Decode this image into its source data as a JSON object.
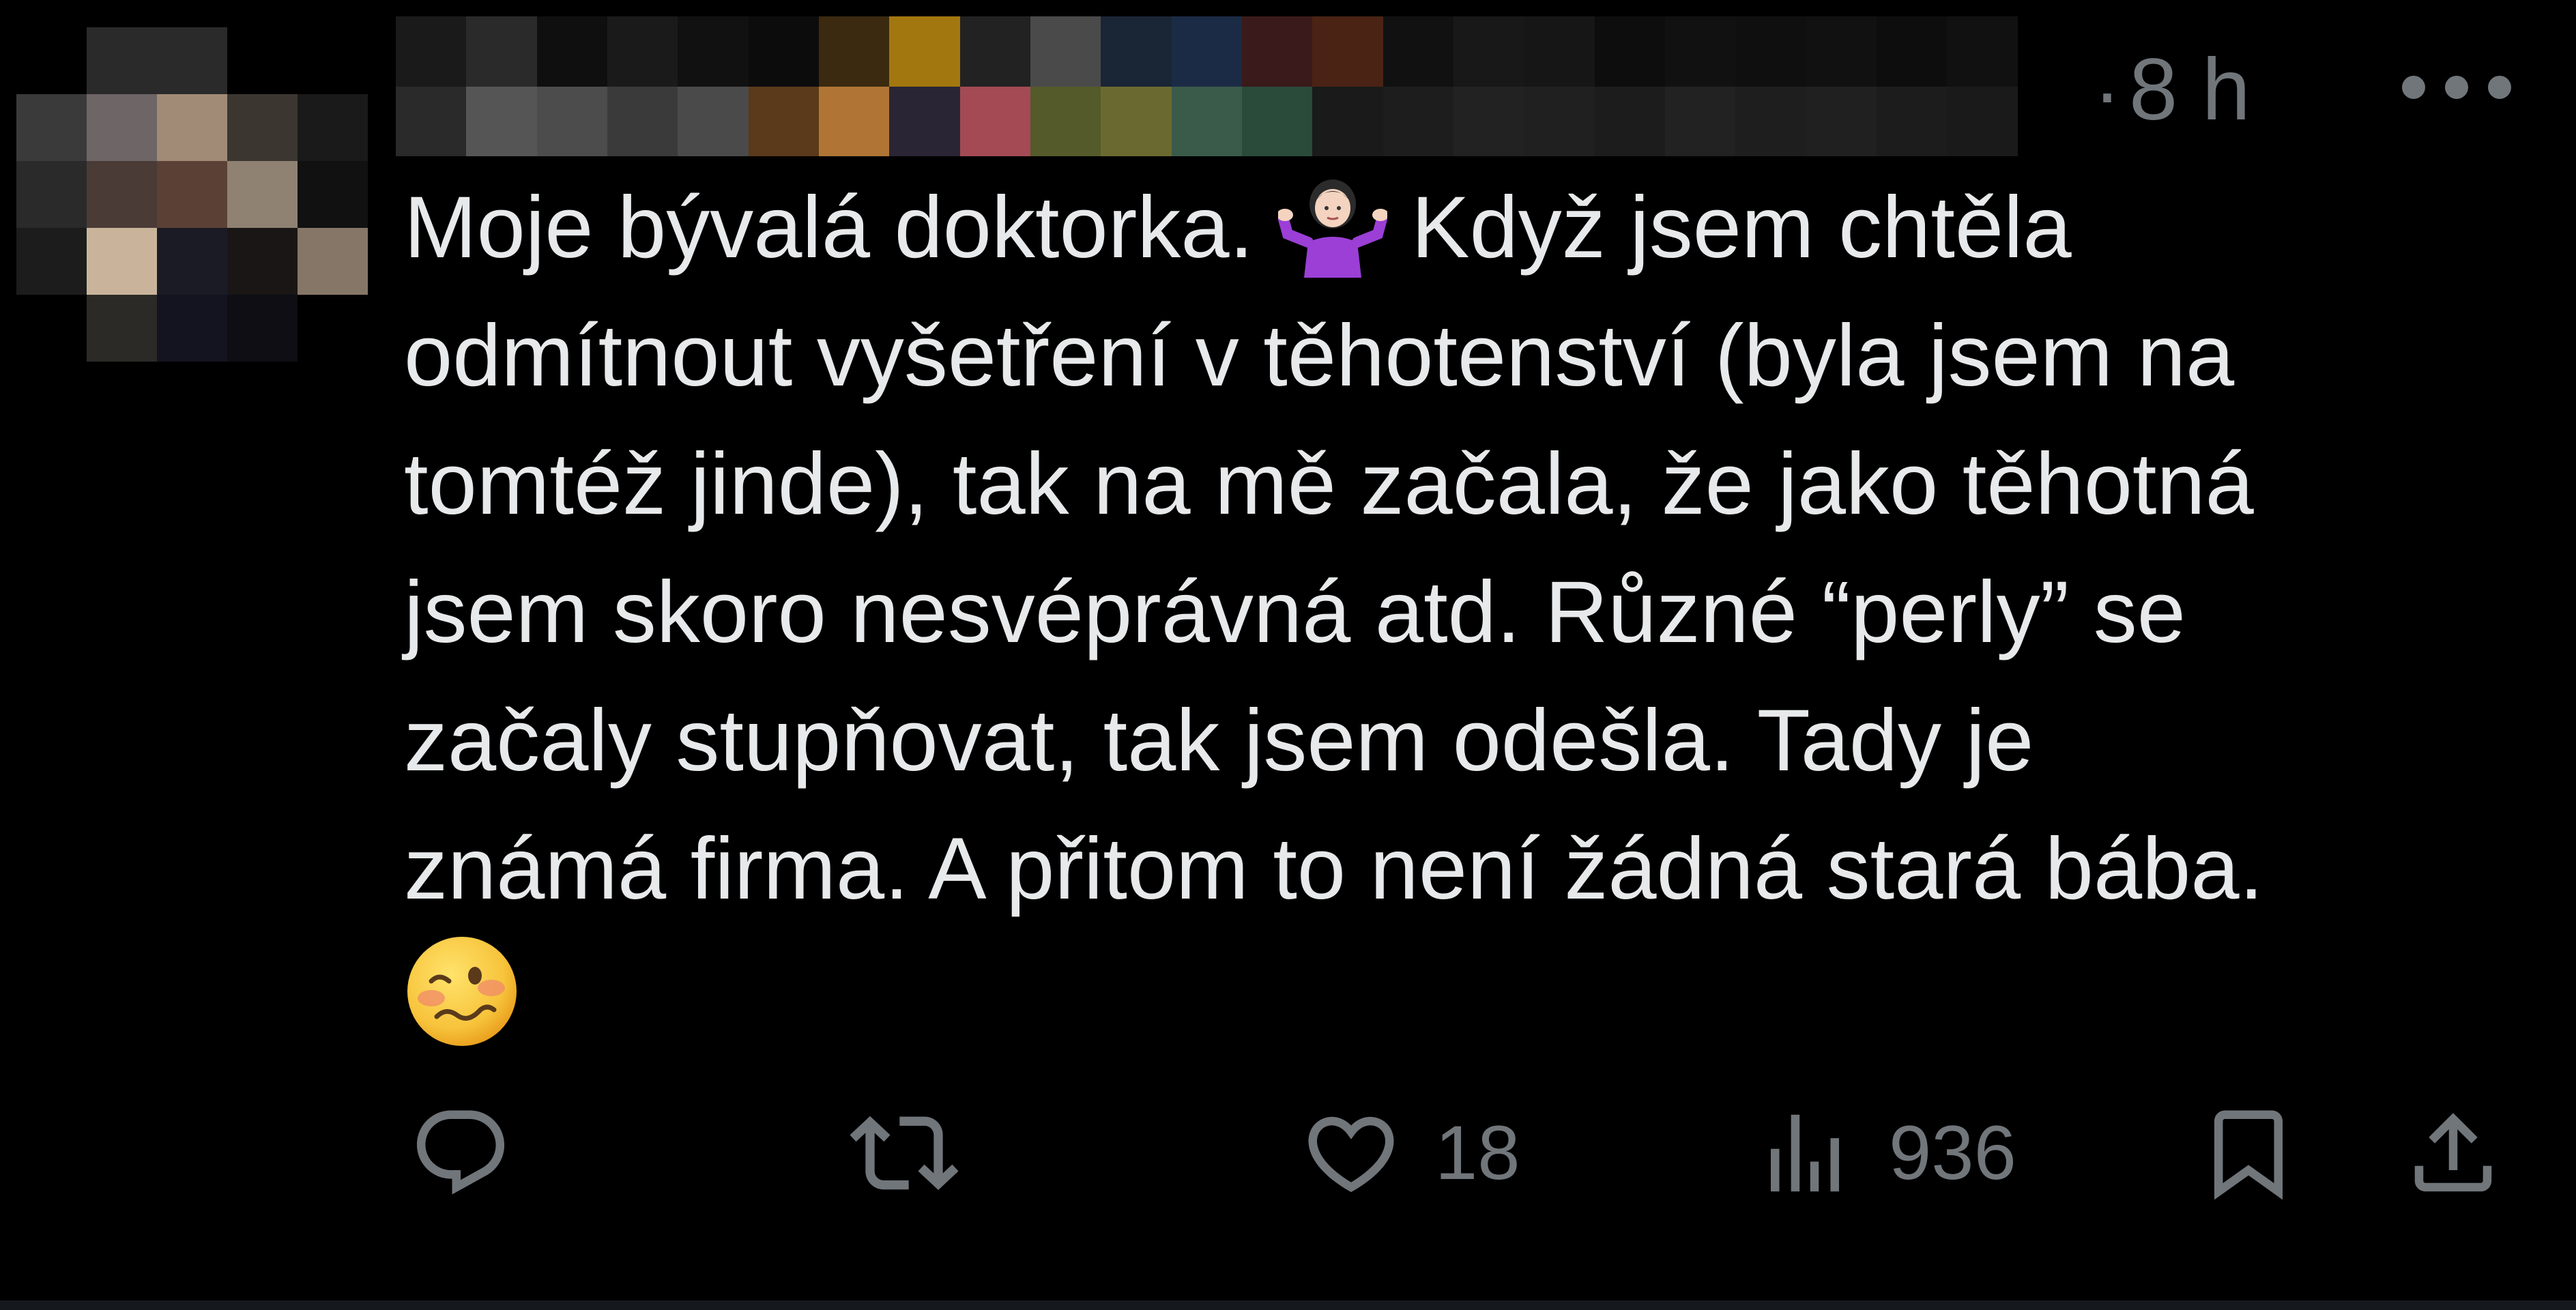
{
  "post": {
    "author_name": "",
    "timestamp": "8 h",
    "separator": "·",
    "text_part1": "Moje bývalá doktorka. ",
    "text_emoji1": "person-shrugging-emoji",
    "text_part2": " Když jsem chtěla\nodmítnout vyšetření v těhotenství (byla jsem na\ntomtéž jinde), tak na mě začala, že jako těhotná\njsem skoro nesvéprávná atd. Různé “perly” se\nzačaly stupňovat, tak jsem odešla. Tady je\nznámá firma. A přitom to není žádná stará bába.\n",
    "text_emoji2": "woozy-face-emoji"
  },
  "actions": {
    "reply_count": "",
    "repost_count": "",
    "like_count": "18",
    "view_count": "936"
  },
  "icons": {
    "reply": "reply-icon",
    "repost": "repost-icon",
    "like": "heart-icon",
    "views": "views-icon",
    "bookmark": "bookmark-icon",
    "share": "share-icon",
    "more": "more-icon"
  },
  "colors": {
    "background": "#000000",
    "text": "#e7e9ea",
    "secondary": "#71767b",
    "shrug_emoji_shirt": "#9b3fd6",
    "woozy_emoji_face": "#f7c33b"
  }
}
